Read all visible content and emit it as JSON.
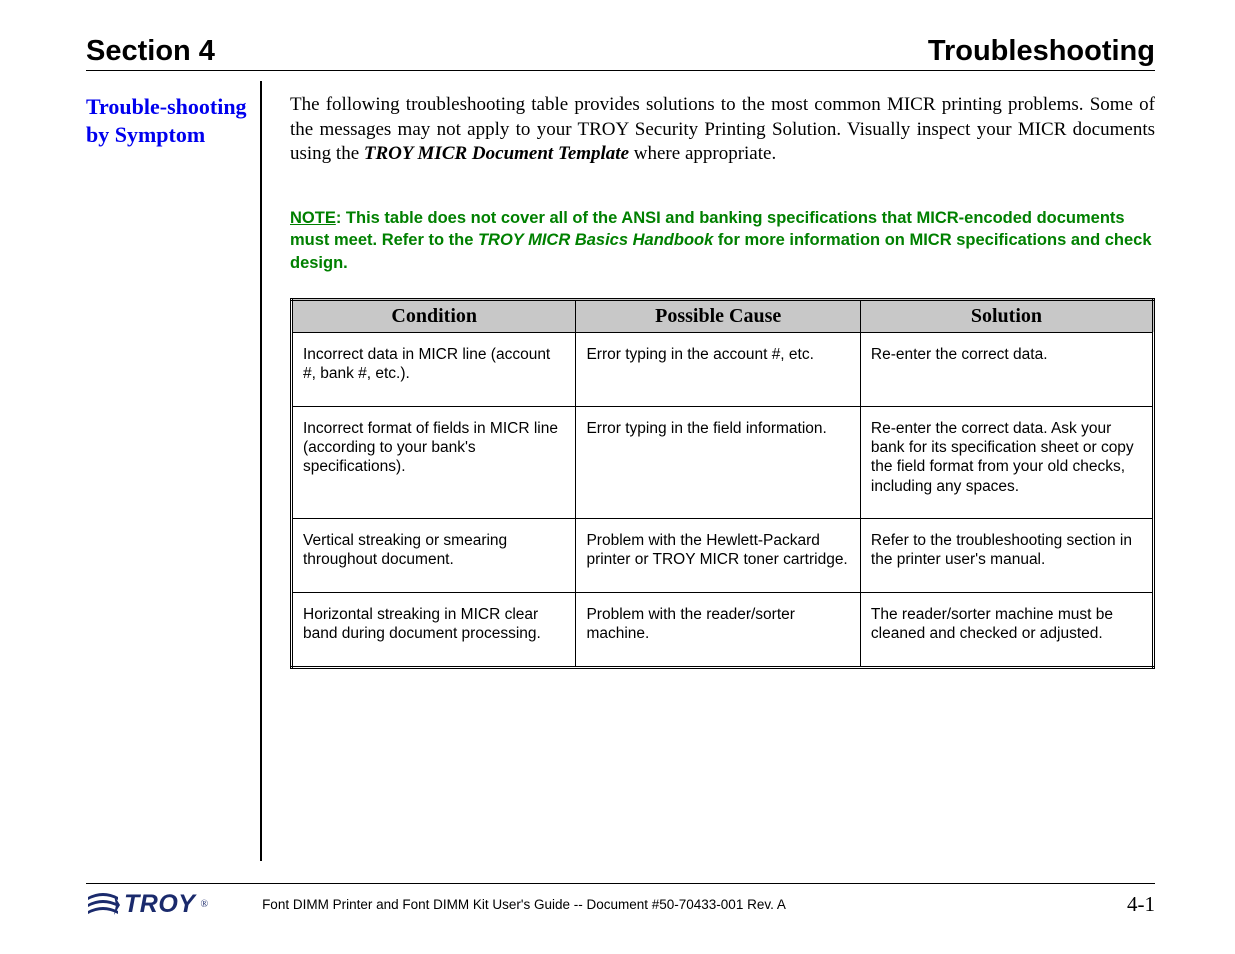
{
  "header": {
    "section": "Section 4",
    "title": "Troubleshooting"
  },
  "sidebar": {
    "title": "Trouble-shooting by Symptom"
  },
  "intro": {
    "part1": "The following troubleshooting table provides solutions to the most common MICR printing problems. Some of the messages may not apply to your TROY Security Printing Solution.  Visually inspect your MICR documents using the ",
    "template": "TROY MICR Document Template",
    "part2": " where appropriate."
  },
  "note": {
    "label": "NOTE",
    "part1": ": This table does not cover all of the ANSI and banking specifications that MICR-encoded documents must meet.  Refer to the ",
    "handbook": "TROY MICR Basics Handbook",
    "part2": " for more information on MICR specifications and check design."
  },
  "table": {
    "headers": {
      "c1": "Condition",
      "c2": "Possible Cause",
      "c3": "Solution"
    },
    "rows": [
      {
        "condition": "Incorrect data in MICR line (account #, bank #, etc.).",
        "cause": "Error typing in the account #, etc.",
        "solution": "Re-enter the correct data."
      },
      {
        "condition": "Incorrect format of fields in MICR line (according to your bank's specifications).",
        "cause": "Error typing in the field information.",
        "solution": "Re-enter the correct data.  Ask your bank for its specification sheet or copy the field format from your old checks, including any spaces."
      },
      {
        "condition": "Vertical streaking or smearing throughout document.",
        "cause": "Problem with the Hewlett-Packard printer or TROY MICR toner cartridge.",
        "solution": "Refer to the troubleshooting section in the printer user's manual."
      },
      {
        "condition": "Horizontal streaking in MICR clear band during document processing.",
        "cause": "Problem with the reader/sorter machine.",
        "solution": "The reader/sorter machine must be cleaned and checked or adjusted."
      }
    ]
  },
  "footer": {
    "logo_text": "TROY",
    "logo_reg": "®",
    "doc": "Font DIMM Printer and Font DIMM Kit User's Guide -- Document #50-70433-001  Rev. A",
    "page": "4-1"
  }
}
